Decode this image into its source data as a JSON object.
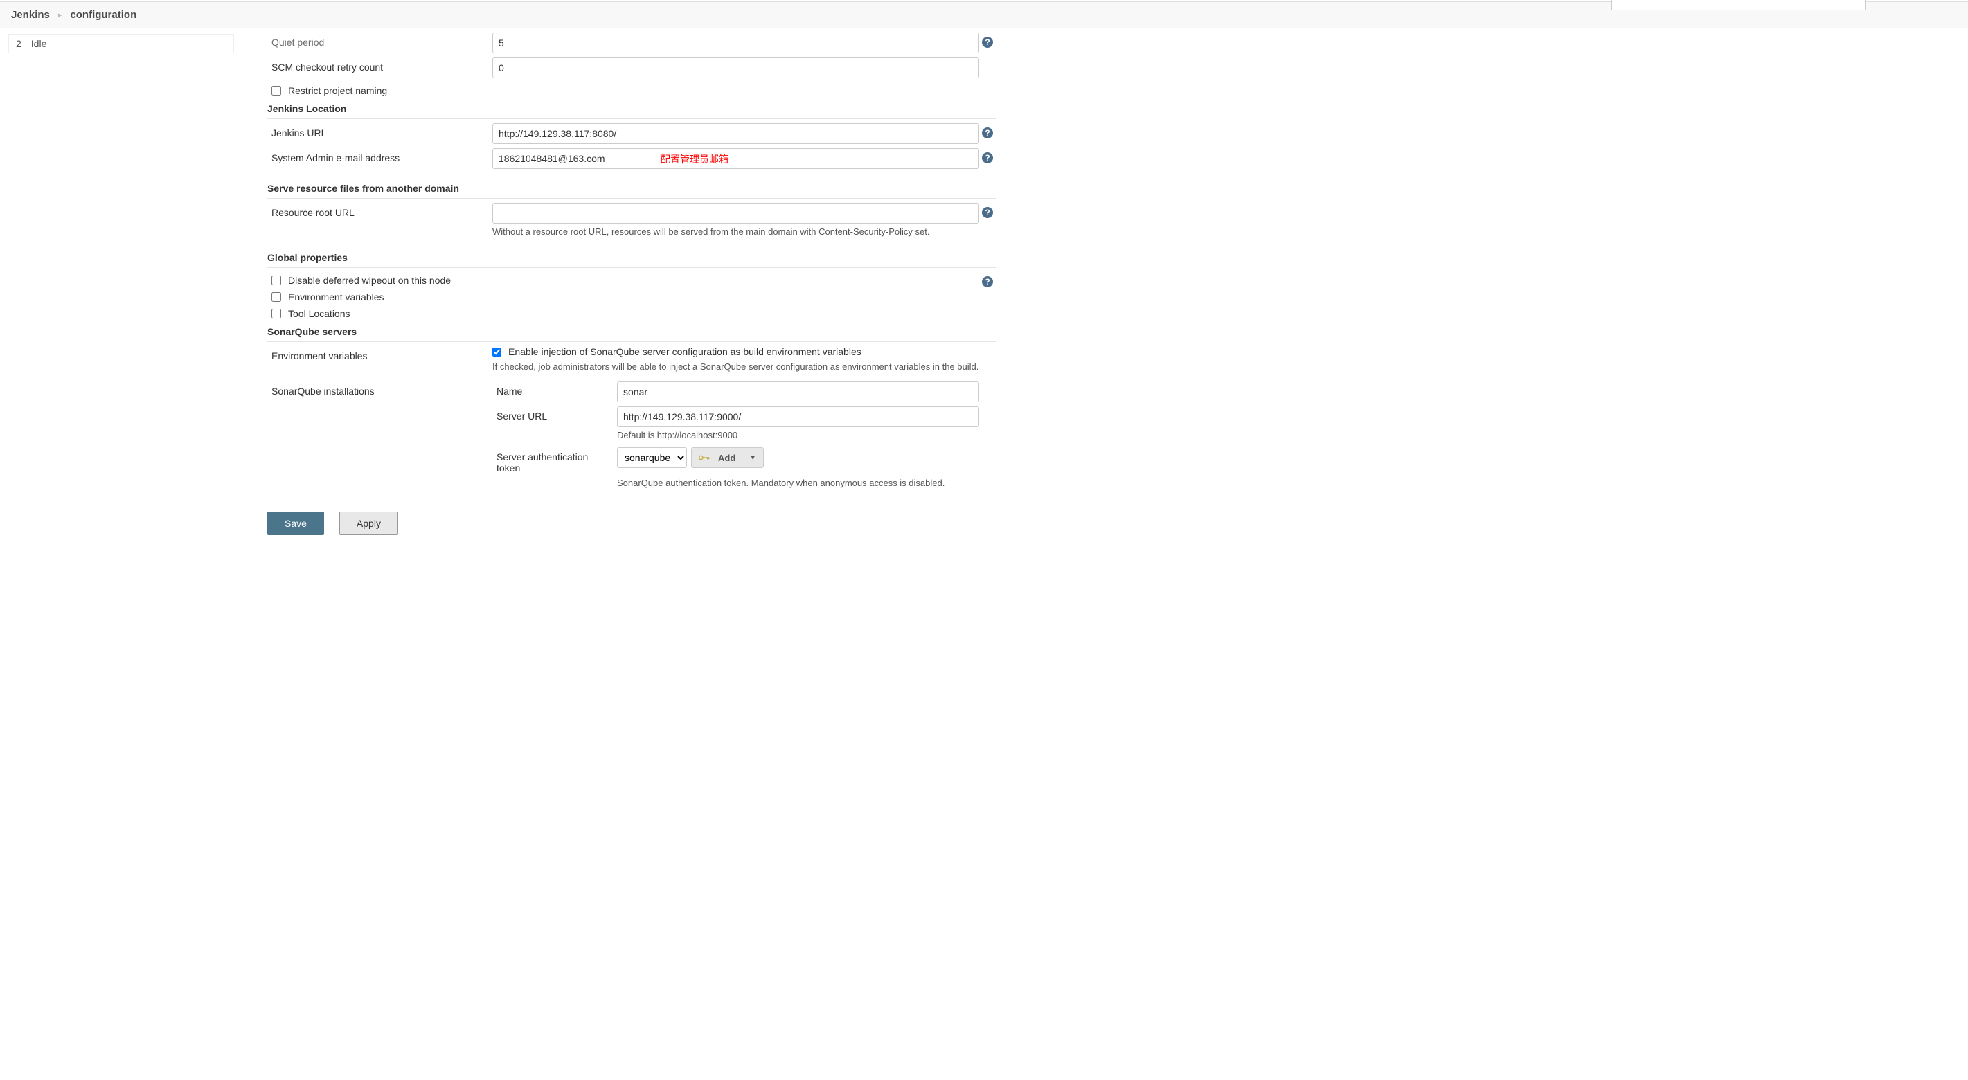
{
  "breadcrumb": {
    "root": "Jenkins",
    "page": "configuration"
  },
  "sidebar": {
    "executors": [
      {
        "num": "2",
        "status": "Idle"
      }
    ]
  },
  "form": {
    "quiet_period": {
      "label": "Quiet period",
      "value": "5"
    },
    "scm_retry": {
      "label": "SCM checkout retry count",
      "value": "0"
    },
    "restrict_naming": {
      "label": "Restrict project naming"
    },
    "section_jenkins_location": "Jenkins Location",
    "jenkins_url": {
      "label": "Jenkins URL",
      "value": "http://149.129.38.117:8080/"
    },
    "admin_email": {
      "label": "System Admin e-mail address",
      "value": "18621048481@163.com",
      "annotation": "配置管理员邮箱"
    },
    "section_resource_domain": "Serve resource files from another domain",
    "resource_root": {
      "label": "Resource root URL",
      "value": "",
      "desc": "Without a resource root URL, resources will be served from the main domain with Content-Security-Policy set."
    },
    "section_global_props": "Global properties",
    "disable_deferred_wipeout": {
      "label": "Disable deferred wipeout on this node"
    },
    "env_vars_checkbox": {
      "label": "Environment variables"
    },
    "tool_locations": {
      "label": "Tool Locations"
    },
    "section_sonarqube": "SonarQube servers",
    "sonar_env_vars": {
      "label": "Environment variables",
      "checkbox_label": "Enable injection of SonarQube server configuration as build environment variables",
      "desc": "If checked, job administrators will be able to inject a SonarQube server configuration as environment variables in the build."
    },
    "sonar_installations": {
      "label": "SonarQube installations",
      "name": {
        "label": "Name",
        "value": "sonar"
      },
      "server_url": {
        "label": "Server URL",
        "value": "http://149.129.38.117:9000/",
        "desc": "Default is http://localhost:9000"
      },
      "auth_token": {
        "label": "Server authentication token",
        "selected": "sonarqube",
        "add_label": "Add",
        "desc": "SonarQube authentication token. Mandatory when anonymous access is disabled."
      }
    }
  },
  "footer": {
    "save": "Save",
    "apply": "Apply"
  }
}
